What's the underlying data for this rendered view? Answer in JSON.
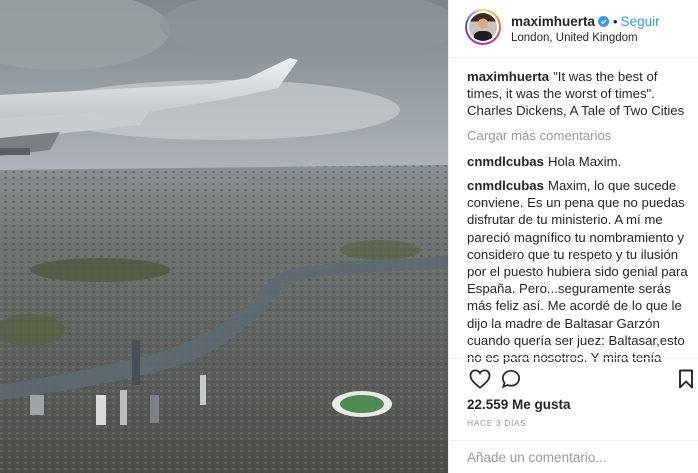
{
  "post": {
    "username": "maximhuerta",
    "follow_label": "Seguir",
    "location": "London, United Kingdom",
    "caption": "\"It was the best of times, it was the worst of times\". Charles Dickens, A Tale of Two Cities"
  },
  "comments": {
    "load_more_label": "Cargar más comentarios",
    "items": [
      {
        "user": "cnmdlcubas",
        "text": "Hola Maxim."
      },
      {
        "user": "cnmdlcubas",
        "text": "Maxim, lo que sucede conviene. Es un pena que no puedas disfrutar de tu ministerio. A mí me pareció magnífico tu nombramiento y considero que tu respeto y tu ilusión por el puesto hubiera sido genial para España. Pero...seguramente serás más feliz así. Me acordé de lo que le dijo la madre de Baltasar Garzón cuando quería ser juez: Baltasar,esto no es para nosotros. Y mira tenía razón. Tu honradez ( sí, honradez repito ) no hubiera encajado bien en un consejo de mInistros."
      }
    ]
  },
  "actions": {
    "like_icon": "heart-icon",
    "comment_icon": "speech-bubble-icon",
    "save_icon": "bookmark-icon"
  },
  "stats": {
    "likes": "22.559 Me gusta",
    "time": "HACE 3 DÍAS"
  },
  "add_comment": {
    "placeholder": "Añade un comentario..."
  },
  "colors": {
    "accent": "#3897f0",
    "text": "#262626",
    "muted": "#999999",
    "border": "#efefef"
  }
}
